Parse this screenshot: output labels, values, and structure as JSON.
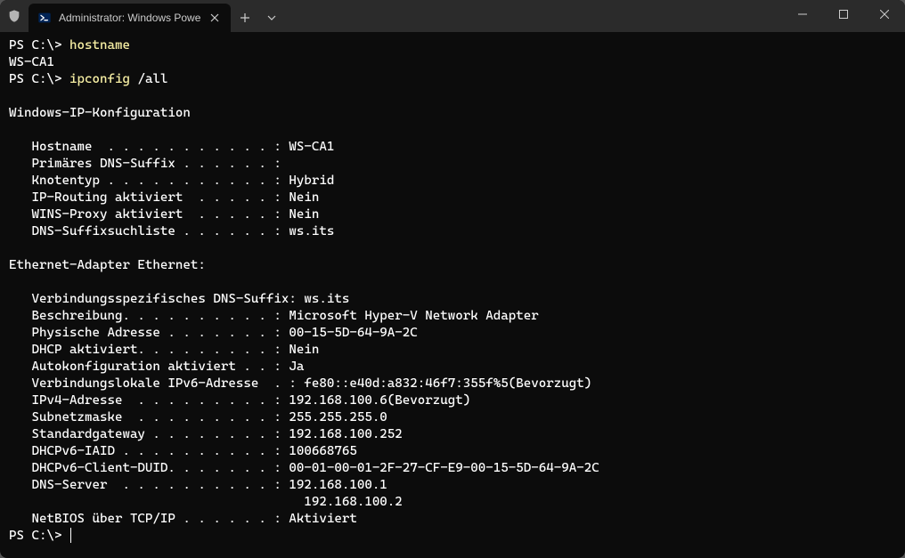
{
  "window": {
    "tab_title": "Administrator: Windows Powe",
    "icons": {
      "shield": "shield-icon",
      "ps": "powershell-icon",
      "close_tab": "close-icon",
      "new_tab": "plus-icon",
      "dropdown": "chevron-down-icon",
      "minimize": "minimize-icon",
      "maximize": "maximize-icon",
      "close_win": "close-icon"
    }
  },
  "terminal": {
    "prompt": "PS C:\\>",
    "lines": {
      "l0_cmd": "hostname",
      "l1": "WS-CA1",
      "l2_cmd": "ipconfig",
      "l2_arg": "/all",
      "l3": "",
      "l4": "Windows-IP-Konfiguration",
      "l5": "",
      "l6": "   Hostname  . . . . . . . . . . . : WS-CA1",
      "l7": "   Primäres DNS-Suffix . . . . . . :",
      "l8": "   Knotentyp . . . . . . . . . . . : Hybrid",
      "l9": "   IP-Routing aktiviert  . . . . . : Nein",
      "l10": "   WINS-Proxy aktiviert  . . . . . : Nein",
      "l11": "   DNS-Suffixsuchliste . . . . . . : ws.its",
      "l12": "",
      "l13": "Ethernet-Adapter Ethernet:",
      "l14": "",
      "l15": "   Verbindungsspezifisches DNS-Suffix: ws.its",
      "l16": "   Beschreibung. . . . . . . . . . : Microsoft Hyper-V Network Adapter",
      "l17": "   Physische Adresse . . . . . . . : 00-15-5D-64-9A-2C",
      "l18": "   DHCP aktiviert. . . . . . . . . : Nein",
      "l19": "   Autokonfiguration aktiviert . . : Ja",
      "l20": "   Verbindungslokale IPv6-Adresse  . : fe80::e40d:a832:46f7:355f%5(Bevorzugt)",
      "l21": "   IPv4-Adresse  . . . . . . . . . : 192.168.100.6(Bevorzugt)",
      "l22": "   Subnetzmaske  . . . . . . . . . : 255.255.255.0",
      "l23": "   Standardgateway . . . . . . . . : 192.168.100.252",
      "l24": "   DHCPv6-IAID . . . . . . . . . . : 100668765",
      "l25": "   DHCPv6-Client-DUID. . . . . . . : 00-01-00-01-2F-27-CF-E9-00-15-5D-64-9A-2C",
      "l26": "   DNS-Server  . . . . . . . . . . : 192.168.100.1",
      "l27": "                                       192.168.100.2",
      "l28": "   NetBIOS über TCP/IP . . . . . . : Aktiviert"
    }
  }
}
